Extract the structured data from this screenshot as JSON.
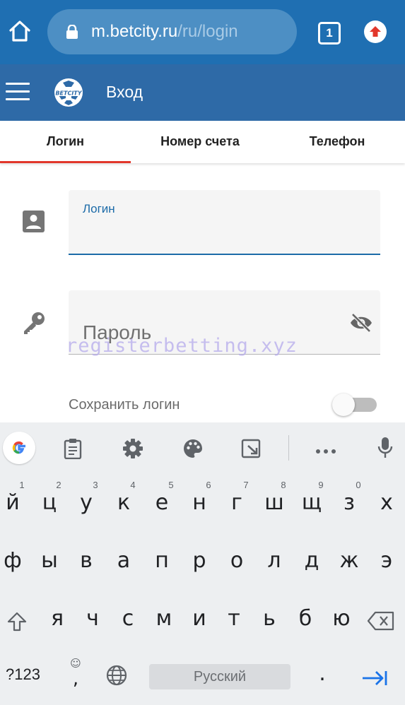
{
  "browser": {
    "url_domain": "m.betcity.ru",
    "url_path": "/ru/login",
    "tab_count": "1"
  },
  "header": {
    "title": "Вход",
    "logo_text": "BETCITY"
  },
  "tabs": [
    {
      "label": "Логин",
      "active": true
    },
    {
      "label": "Номер счета",
      "active": false
    },
    {
      "label": "Телефон",
      "active": false
    }
  ],
  "form": {
    "login_label": "Логин",
    "password_placeholder": "Пароль",
    "remember_label": "Сохранить логин",
    "remember_on": false
  },
  "watermark": "registerbetting.xyz",
  "keyboard": {
    "row1": [
      "й",
      "ц",
      "у",
      "к",
      "е",
      "н",
      "г",
      "ш",
      "щ",
      "з",
      "х"
    ],
    "row1_numbers": [
      "1",
      "2",
      "3",
      "4",
      "5",
      "6",
      "7",
      "8",
      "9",
      "0"
    ],
    "row2": [
      "ф",
      "ы",
      "в",
      "а",
      "п",
      "р",
      "о",
      "л",
      "д",
      "ж",
      "э"
    ],
    "row3": [
      "я",
      "ч",
      "с",
      "м",
      "и",
      "т",
      "ь",
      "б",
      "ю"
    ],
    "symbols_key": "?123",
    "comma_key": ",",
    "space_label": "Русский",
    "period_key": "."
  },
  "colors": {
    "browser_bar": "#1f6fb2",
    "app_header": "#2e6aa7",
    "active_tab_indicator": "#e2372b",
    "accent": "#1c6ba8"
  }
}
